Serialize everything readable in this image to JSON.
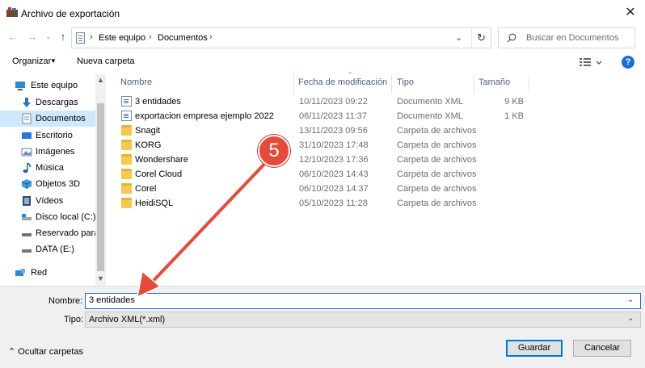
{
  "window": {
    "title": "Archivo de exportación",
    "close": "✕"
  },
  "nav": {
    "back": "←",
    "forward": "→",
    "recent": "⌄",
    "up": "↑"
  },
  "address": {
    "segments": [
      "Este equipo",
      "Documentos"
    ],
    "chevron": "›",
    "dropdown": "⌄",
    "refresh": "↻"
  },
  "search": {
    "placeholder": "Buscar en Documentos"
  },
  "toolbar": {
    "organize": "Organizar",
    "organize_caret": "▼",
    "new_folder": "Nueva carpeta",
    "help": "?"
  },
  "sidebar": {
    "items": [
      {
        "label": "Este equipo"
      },
      {
        "label": "Descargas"
      },
      {
        "label": "Documentos"
      },
      {
        "label": "Escritorio"
      },
      {
        "label": "Imágenes"
      },
      {
        "label": "Música"
      },
      {
        "label": "Objetos 3D"
      },
      {
        "label": "Vídeos"
      },
      {
        "label": "Disco local (C:)"
      },
      {
        "label": "Reservado para el"
      },
      {
        "label": "DATA (E:)"
      },
      {
        "label": "Red"
      }
    ],
    "scroll_up": "▲",
    "scroll_down": "▼"
  },
  "columns": {
    "name": "Nombre",
    "date": "Fecha de modificación",
    "type": "Tipo",
    "size": "Tamaño",
    "sort_caret": "⌃"
  },
  "files": [
    {
      "name": "3 entidades",
      "date": "10/11/2023 09:22",
      "type": "Documento XML",
      "size": "9 KB",
      "kind": "xml"
    },
    {
      "name": "exportacion empresa ejemplo 2022",
      "date": "06/11/2023 11:37",
      "type": "Documento XML",
      "size": "1 KB",
      "kind": "xml"
    },
    {
      "name": "Snagit",
      "date": "13/11/2023 09:56",
      "type": "Carpeta de archivos",
      "size": "",
      "kind": "folder"
    },
    {
      "name": "KORG",
      "date": "31/10/2023 17:48",
      "type": "Carpeta de archivos",
      "size": "",
      "kind": "folder"
    },
    {
      "name": "Wondershare",
      "date": "12/10/2023 17:36",
      "type": "Carpeta de archivos",
      "size": "",
      "kind": "folder"
    },
    {
      "name": "Corel Cloud",
      "date": "06/10/2023 14:43",
      "type": "Carpeta de archivos",
      "size": "",
      "kind": "folder"
    },
    {
      "name": "Corel",
      "date": "06/10/2023 14:37",
      "type": "Carpeta de archivos",
      "size": "",
      "kind": "folder"
    },
    {
      "name": "HeidiSQL",
      "date": "05/10/2023 11:28",
      "type": "Carpeta de archivos",
      "size": "",
      "kind": "folder"
    }
  ],
  "form": {
    "name_label": "Nombre:",
    "name_value": "3 entidades",
    "type_label": "Tipo:",
    "type_value": "Archivo XML(*.xml)",
    "dropdown": "⌄"
  },
  "footer": {
    "hide_folders": "⌃  Ocultar carpetas",
    "save": "Guardar",
    "cancel": "Cancelar"
  },
  "annotation": {
    "step": "5",
    "color": "#e84a3a"
  }
}
